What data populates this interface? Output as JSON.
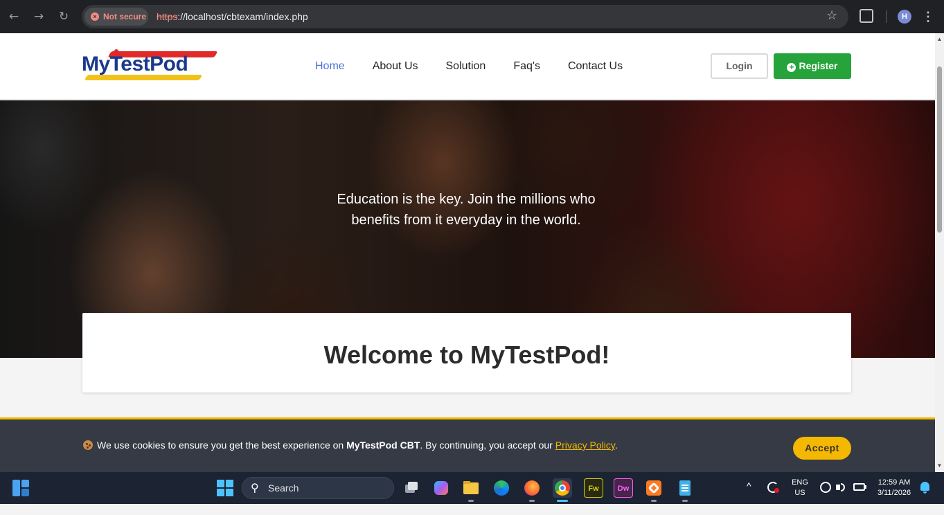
{
  "browser": {
    "back_glyph": "←",
    "forward_glyph": "→",
    "reload_glyph": "↻",
    "security_label": "Not secure",
    "security_glyph": "×",
    "url_scheme": "https",
    "url_rest": "://localhost/cbtexam/index.php",
    "star_glyph": "☆",
    "profile_initial": "H",
    "menu_glyph": "⋮"
  },
  "site": {
    "logo_text": "MyTestPod",
    "nav": [
      {
        "label": "Home",
        "active": true
      },
      {
        "label": "About Us",
        "active": false
      },
      {
        "label": "Solution",
        "active": false
      },
      {
        "label": "Faq's",
        "active": false
      },
      {
        "label": "Contact Us",
        "active": false
      }
    ],
    "login_label": "Login",
    "register_label": "Register",
    "register_icon": "+"
  },
  "hero": {
    "tagline_line1": "Education is the key. Join the millions who",
    "tagline_line2": "benefits from it everyday in the world."
  },
  "welcome": {
    "title": "Welcome to MyTestPod!"
  },
  "cookie": {
    "text_before": "We use cookies to ensure you get the best experience on ",
    "brand": "MyTestPod CBT",
    "text_middle": ". By continuing, you accept our ",
    "link": "Privacy Policy",
    "text_end": ".",
    "accept_label": "Accept"
  },
  "taskbar": {
    "search_label": "Search",
    "search_glyph": "⚲",
    "apps": [
      {
        "name": "task-view",
        "label": ""
      },
      {
        "name": "copilot",
        "label": ""
      },
      {
        "name": "file-explorer",
        "label": ""
      },
      {
        "name": "edge",
        "label": ""
      },
      {
        "name": "firefox",
        "label": ""
      },
      {
        "name": "chrome",
        "label": ""
      },
      {
        "name": "fireworks",
        "label": "Fw"
      },
      {
        "name": "dreamweaver",
        "label": "Dw"
      },
      {
        "name": "xampp",
        "label": ""
      },
      {
        "name": "notepad",
        "label": ""
      }
    ],
    "tray_chevron": "^",
    "lang_line1": "ENG",
    "lang_line2": "US",
    "time": "12:59 AM",
    "date": "3/11/2026"
  },
  "colors": {
    "accent_nav": "#4d6fd6",
    "register_green": "#27a33b",
    "cookie_yellow": "#f5b800",
    "logo_blue": "#1a3a8c"
  }
}
